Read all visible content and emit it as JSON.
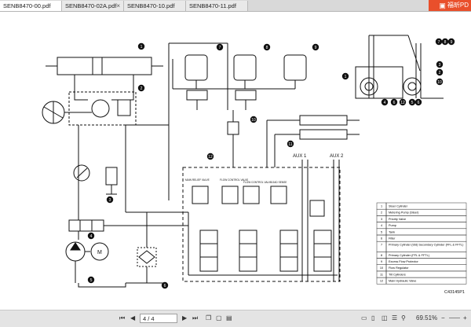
{
  "tabs": [
    {
      "label": "SENB8470-00.pdf"
    },
    {
      "label": "SENB8470-02A.pdf"
    },
    {
      "label": "SENB8470-10.pdf"
    },
    {
      "label": "SENB8470-11.pdf"
    }
  ],
  "brand": {
    "label": "福昕PD"
  },
  "diagram": {
    "callouts": [
      "1",
      "2",
      "3",
      "4",
      "5",
      "6",
      "7",
      "8",
      "9",
      "10",
      "11",
      "12"
    ],
    "forklift_callouts": [
      "7",
      "8",
      "9",
      "3",
      "2",
      "10",
      "1",
      "4",
      "6",
      "12",
      "5",
      "6"
    ],
    "aux1": "AUX 1",
    "aux2": "AUX 2",
    "figure_id": "C43145P1",
    "legend": [
      {
        "num": "1",
        "text": "Steer Cylinder"
      },
      {
        "num": "2",
        "text": "Metering Pump (Steer)"
      },
      {
        "num": "3",
        "text": "Priority Valve"
      },
      {
        "num": "4",
        "text": "Pump"
      },
      {
        "num": "5",
        "text": "Tank"
      },
      {
        "num": "6",
        "text": "Filter"
      },
      {
        "num": "7",
        "text": "Primary Cylinder (Std) Secondary Cylinder (FFL & FFTL)"
      },
      {
        "num": "8",
        "text": "Primary Cylinder (FFL & FFTL)"
      },
      {
        "num": "9",
        "text": "Excess Flow Protector"
      },
      {
        "num": "10",
        "text": "Flow Regulator"
      },
      {
        "num": "11",
        "text": "Tilt Cylinders"
      },
      {
        "num": "12",
        "text": "Main Hydraulic Valve"
      }
    ],
    "m_label": "M",
    "valve_labels": [
      "MAIN RELIEF VALVE",
      "FLOW CONTROL VALVE",
      "FLOW CONTROL VALVE",
      "LOAD SENSE"
    ]
  },
  "statusbar": {
    "page_value": "4 / 4",
    "zoom": "69.51%"
  }
}
